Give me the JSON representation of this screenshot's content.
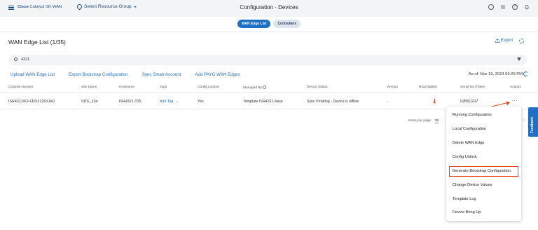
{
  "header": {
    "brand_strong": "Cisco",
    "brand_rest": " Catalyst SD-WAN",
    "resource_group": "Select Resource Group",
    "title": "Configuration · Devices",
    "icons": [
      "cloud-icon",
      "list-icon",
      "help-icon",
      "bell-icon"
    ]
  },
  "tabs": [
    {
      "label": "WAN Edge List",
      "active": true
    },
    {
      "label": "Controllers",
      "active": false
    }
  ],
  "list": {
    "title": "WAN Edge List (1/35)",
    "export_label": "Export"
  },
  "search": {
    "value": "4321"
  },
  "actions": {
    "upload": "Upload WAN Edge List",
    "export_bootstrap": "Export Bootstrap Configuration",
    "sync_smart": "Sync Smart Account",
    "add_payg": "Add PAYG WAN Edges",
    "as_of": "As of:  Mar 19, 2024 09:29 PM"
  },
  "table": {
    "columns": [
      "Chassis Number",
      "Site Name",
      "Hostname",
      "Tags",
      "Config Locked",
      "Managed By",
      "Device Status",
      "Version",
      "Reachability",
      "Serial No./Token",
      "Actions"
    ],
    "row": {
      "chassis": "ISR4321/K9-FDO22263JH0",
      "site": "SITE_104",
      "hostname": "ISR4321-T25",
      "tags": "Add Tag",
      "config_locked": "Yes",
      "managed_by": "Template ISR4321-base",
      "device_status": "Sync Pending - Device is offline",
      "version": "-",
      "serial": "02B5CF07",
      "actions": "···"
    }
  },
  "pager": {
    "label": "Items per page:",
    "value": "25"
  },
  "feedback_label": "Feedback",
  "menu": {
    "items": [
      "Running Configuration",
      "Local Configuration",
      "Delete WAN Edge",
      "Config Unlock",
      "Generate Bootstrap Configuration",
      "Change Device Values",
      "Template Log",
      "Device Bring Up"
    ],
    "highlighted": "Generate Bootstrap Configuration"
  },
  "colors": {
    "accent": "#1e6fc6",
    "brand": "#1d4e89",
    "callout": "#e3431a"
  }
}
